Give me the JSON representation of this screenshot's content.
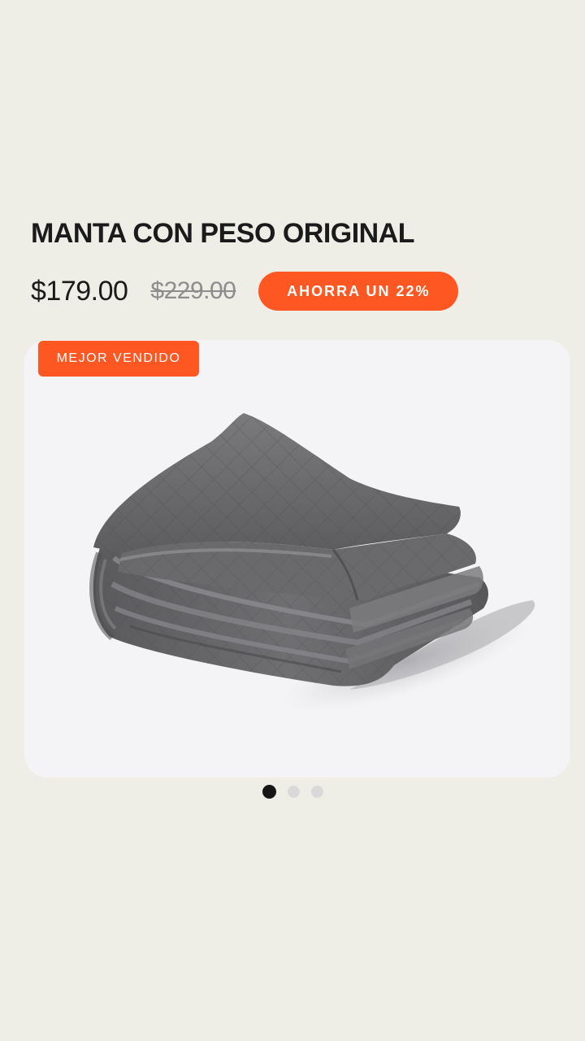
{
  "product": {
    "title": "MANTA CON PESO ORIGINAL",
    "price": "$179.00",
    "original_price": "$229.00",
    "savings_label": "AHORRA UN 22%",
    "badge": "MEJOR VENDIDO",
    "image_icon": "weighted-blanket-image"
  },
  "carousel": {
    "total_slides": 3,
    "active_slide": 1
  },
  "colors": {
    "accent": "#ff5722",
    "background": "#eeede6",
    "card": "#f4f4f6",
    "text": "#1b1b1b",
    "muted": "#8d8d8d"
  }
}
